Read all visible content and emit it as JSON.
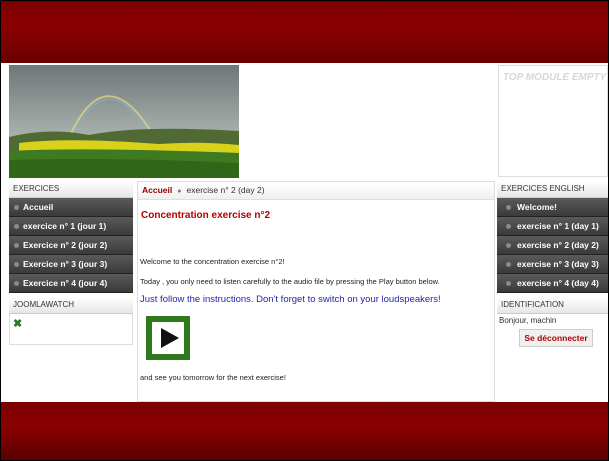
{
  "top_module": {
    "text": "TOP MODULE EMPTY"
  },
  "left": {
    "exercises_title": "EXERCICES",
    "items": [
      {
        "label": "Accueil"
      },
      {
        "label": "exercice n° 1 (jour 1)"
      },
      {
        "label": "Exercice n° 2 (jour 2)"
      },
      {
        "label": "Exercice n° 3 (jour 3)"
      },
      {
        "label": "Exercice n° 4 (jour 4)"
      }
    ],
    "watch_title": "JOOMLAWATCH"
  },
  "right": {
    "exercises_title": "EXERCICES ENGLISH",
    "items": [
      {
        "label": "Welcome!"
      },
      {
        "label": "exercise n° 1 (day 1)"
      },
      {
        "label": "exercise n° 2 (day 2)"
      },
      {
        "label": "exercise n° 3 (day 3)"
      },
      {
        "label": "exercise n° 4 (day 4)"
      }
    ],
    "ident_title": "IDENTIFICATION",
    "greeting": "Bonjour, machin",
    "logout_label": "Se déconnecter"
  },
  "main": {
    "breadcrumb_home": "Accueil",
    "breadcrumb_current": "exercise n° 2 (day 2)",
    "title": "Concentration exercise n°2",
    "p1": "Welcome to the concentration exercise n°2!",
    "p2": "Today , you only need to listen carefully to the audio file by pressing the Play button below.",
    "p3": "Just follow the instructions. Don't forget to switch on your loudspeakers!",
    "p4": "and see you tomorrow for the next exercise!"
  }
}
